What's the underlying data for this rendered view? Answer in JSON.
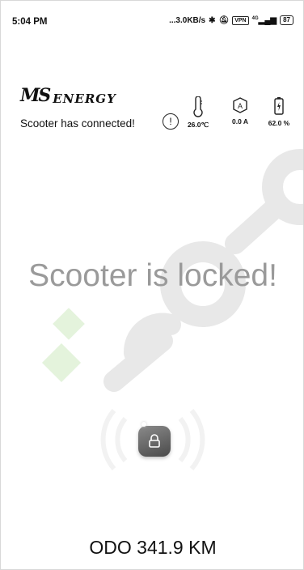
{
  "status_bar": {
    "time": "5:04 PM",
    "net_speed": "...3.0KB/s",
    "bluetooth_icon": "bluetooth-icon",
    "mute_icon": "bell-off-icon",
    "vpn_label": "VPN",
    "signal_label": "4G",
    "battery_level": "87"
  },
  "header": {
    "brand_mark": "MS",
    "brand_word": "ENERGY",
    "connection_text": "Scooter has connected!",
    "alert_symbol": "!",
    "metrics": [
      {
        "icon": "thermometer-icon",
        "value": "26.0℃"
      },
      {
        "icon": "current-icon",
        "value": "0.0 A"
      },
      {
        "icon": "battery-icon",
        "value": "62.0 %"
      }
    ]
  },
  "main": {
    "lock_status": "Scooter is locked!",
    "lock_icon": "padlock-icon",
    "odometer": "ODO 341.9 KM"
  },
  "colors": {
    "status_text": "#9a9a9a",
    "lock_button": "#6a6a6a",
    "watermark": "#e6e6e6",
    "watermark_green": "#e4f3dc"
  }
}
